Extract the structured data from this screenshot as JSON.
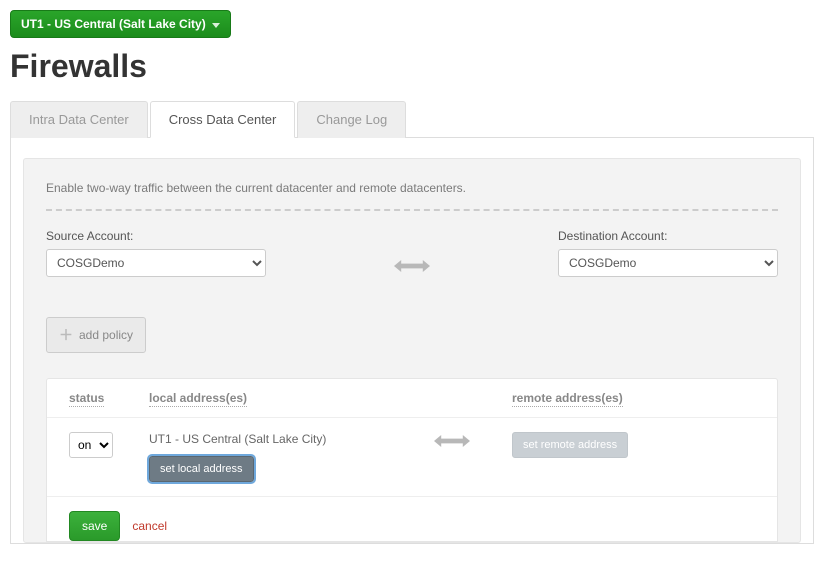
{
  "datacenter_selector": {
    "label": "UT1 - US Central (Salt Lake City)"
  },
  "page_title": "Firewalls",
  "tabs": [
    {
      "label": "Intra Data Center",
      "active": false
    },
    {
      "label": "Cross Data Center",
      "active": true
    },
    {
      "label": "Change Log",
      "active": false
    }
  ],
  "panel": {
    "description": "Enable two-way traffic between the current datacenter and remote datacenters.",
    "source_account_label": "Source Account:",
    "destination_account_label": "Destination Account:",
    "source_account_value": "COSGDemo",
    "destination_account_value": "COSGDemo",
    "add_policy_label": "add policy"
  },
  "rules": {
    "headers": {
      "status": "status",
      "local": "local address(es)",
      "remote": "remote address(es)"
    },
    "row": {
      "status_value": "on",
      "local_dc": "UT1 - US Central (Salt Lake City)",
      "set_local_label": "set local address",
      "set_remote_label": "set remote address"
    },
    "actions": {
      "save": "save",
      "cancel": "cancel"
    }
  }
}
